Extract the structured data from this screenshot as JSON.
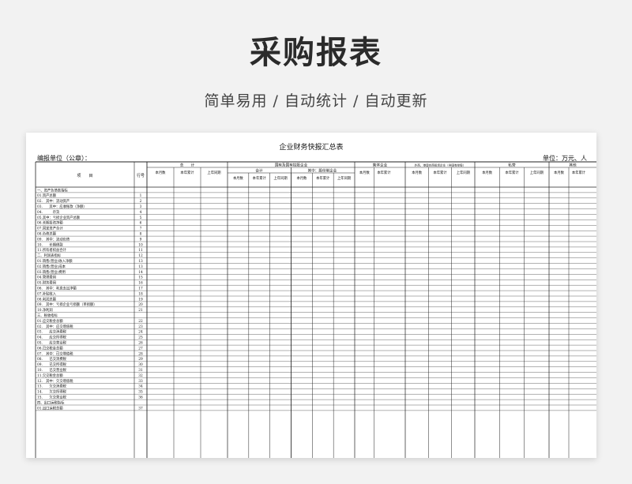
{
  "page": {
    "title": "采购报表",
    "subtitle": "简单易用  /  自动统计  /  自动更新"
  },
  "sheet": {
    "title": "企业财务快报汇总表",
    "unit_left": "编报单位（公章）：",
    "unit_right": "单位：万元、人",
    "header": {
      "item": "项　　目",
      "row_no": "行号",
      "groups": [
        "总　　计",
        "国有及国有控股企业",
        "集体企业",
        "外商、港澳台商投资企业（非国有控股）",
        "私营",
        "其他"
      ],
      "subgroups": [
        "合计",
        "其中：股份制企业"
      ],
      "cols": [
        "本月数",
        "本年累计",
        "上年同期"
      ]
    },
    "rows": [
      [
        "一、资产负债表指标",
        ""
      ],
      [
        "01.资产总额",
        "1"
      ],
      [
        "02.　其中：流动资产",
        "2"
      ],
      [
        "03.　　其中：应收账款（净额）",
        "3"
      ],
      [
        "04.　　　存货",
        "4"
      ],
      [
        "05.其中：亏损企业资产总额",
        "5"
      ],
      [
        "06.长期投资净额",
        "6"
      ],
      [
        "07.固定资产合计",
        "7"
      ],
      [
        "08.负债总额",
        "8"
      ],
      [
        "09.　其中：流动负债",
        "9"
      ],
      [
        "10.　　长期借款",
        "10"
      ],
      [
        "11.所有者权益合计",
        "11"
      ],
      [
        "二、利润表指标",
        "12"
      ],
      [
        "01.销售(营业)收入净额",
        "13"
      ],
      [
        "02.销售(营业)成本",
        "13"
      ],
      [
        "03.销售(营业)费用",
        "14"
      ],
      [
        "04.管理费用",
        "15"
      ],
      [
        "05.财务费用",
        "16"
      ],
      [
        "06.　其中：利息支出净额",
        "17"
      ],
      [
        "07.补贴收入",
        "18"
      ],
      [
        "08.利润总额",
        "19"
      ],
      [
        "09.　其中：亏损企业亏损额（单损额）",
        "20"
      ],
      [
        "10.净利润",
        "21"
      ],
      [
        "三、税收指标",
        ""
      ],
      [
        "01.应交税金总额",
        "22"
      ],
      [
        "02.　其中：应交增值税",
        "23"
      ],
      [
        "03.　　应交消费税",
        "24"
      ],
      [
        "04.　　应交所得税",
        "25"
      ],
      [
        "05.　　应交营业税",
        "26"
      ],
      [
        "06.已交税金总额",
        "27"
      ],
      [
        "07.　其中：已交增值税",
        "28"
      ],
      [
        "08.　　已交消费税",
        "29"
      ],
      [
        "09.　　已交所得税",
        "30"
      ],
      [
        "10.　　已交营业税",
        "31"
      ],
      [
        "11.欠交税金总额",
        "32"
      ],
      [
        "12.　其中：欠交增值税",
        "33"
      ],
      [
        "13.　　欠交消费税",
        "34"
      ],
      [
        "14.　　欠交所得税",
        "35"
      ],
      [
        "15.　　欠交营业税",
        "36"
      ],
      [
        "四、出口运税指标",
        ""
      ],
      [
        "01.出口运税总额",
        "37"
      ]
    ]
  }
}
